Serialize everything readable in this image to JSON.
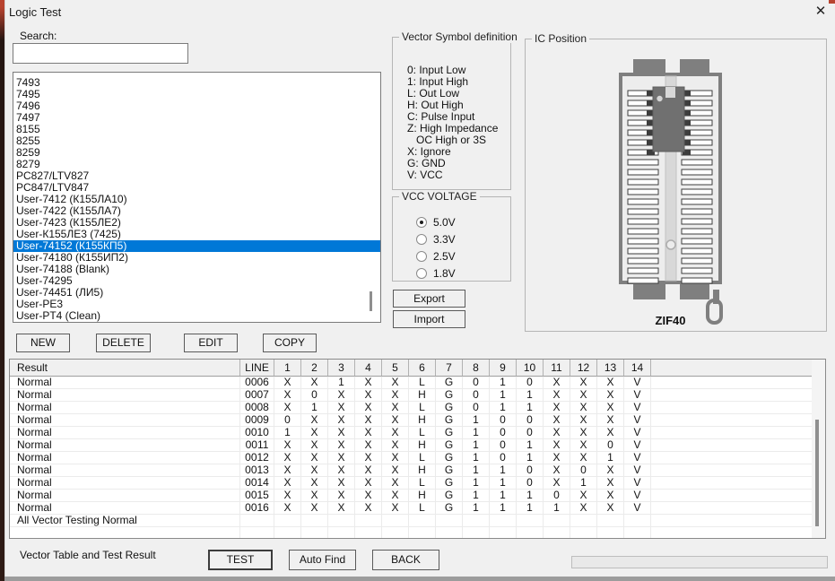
{
  "window": {
    "title": "Logic Test",
    "close_icon": "✕"
  },
  "search": {
    "label": "Search:",
    "value": ""
  },
  "chip_list": {
    "selected_index": 14,
    "items": [
      "7493",
      "7495",
      "7496",
      "7497",
      "8155",
      "8255",
      "8259",
      "8279",
      "PC827/LTV827",
      "PC847/LTV847",
      "User-7412 (К155ЛА10)",
      "User-7422 (К155ЛА7)",
      "User-7423 (К155ЛЕ2)",
      "User-К155ЛЕ3 (7425)",
      "User-74152 (К155КП5)",
      "User-74180 (К155ИП2)",
      "User-74188 (Blank)",
      "User-74295",
      "User-74451 (ЛИ5)",
      "User-PE3",
      "User-PT4 (Clean)"
    ]
  },
  "list_actions": {
    "new": "NEW",
    "delete": "DELETE",
    "edit": "EDIT",
    "copy": "COPY"
  },
  "vector_symbols": {
    "title": "Vector Symbol definition",
    "lines": [
      "0: Input Low",
      "1: Input High",
      "L: Out Low",
      "H: Out High",
      "C: Pulse Input",
      "Z: High Impedance",
      "   OC High or 3S",
      "X: Ignore",
      "G: GND",
      "V: VCC"
    ]
  },
  "vcc_voltage": {
    "title": "VCC VOLTAGE",
    "options": [
      "5.0V",
      "3.3V",
      "2.5V",
      "1.8V"
    ],
    "selected": "5.0V"
  },
  "transfer": {
    "export": "Export",
    "import": "Import"
  },
  "ic_position": {
    "title": "IC Position",
    "socket_label": "ZIF40"
  },
  "vector_table": {
    "result_header": "Result",
    "line_header": "LINE",
    "pin_headers": [
      "1",
      "2",
      "3",
      "4",
      "5",
      "6",
      "7",
      "8",
      "9",
      "10",
      "11",
      "12",
      "13",
      "14"
    ],
    "rows": [
      {
        "result": "Normal",
        "line": "0006",
        "pins": [
          "X",
          "X",
          "1",
          "X",
          "X",
          "L",
          "G",
          "0",
          "1",
          "0",
          "X",
          "X",
          "X",
          "V"
        ]
      },
      {
        "result": "Normal",
        "line": "0007",
        "pins": [
          "X",
          "0",
          "X",
          "X",
          "X",
          "H",
          "G",
          "0",
          "1",
          "1",
          "X",
          "X",
          "X",
          "V"
        ]
      },
      {
        "result": "Normal",
        "line": "0008",
        "pins": [
          "X",
          "1",
          "X",
          "X",
          "X",
          "L",
          "G",
          "0",
          "1",
          "1",
          "X",
          "X",
          "X",
          "V"
        ]
      },
      {
        "result": "Normal",
        "line": "0009",
        "pins": [
          "0",
          "X",
          "X",
          "X",
          "X",
          "H",
          "G",
          "1",
          "0",
          "0",
          "X",
          "X",
          "X",
          "V"
        ]
      },
      {
        "result": "Normal",
        "line": "0010",
        "pins": [
          "1",
          "X",
          "X",
          "X",
          "X",
          "L",
          "G",
          "1",
          "0",
          "0",
          "X",
          "X",
          "X",
          "V"
        ]
      },
      {
        "result": "Normal",
        "line": "0011",
        "pins": [
          "X",
          "X",
          "X",
          "X",
          "X",
          "H",
          "G",
          "1",
          "0",
          "1",
          "X",
          "X",
          "0",
          "V"
        ]
      },
      {
        "result": "Normal",
        "line": "0012",
        "pins": [
          "X",
          "X",
          "X",
          "X",
          "X",
          "L",
          "G",
          "1",
          "0",
          "1",
          "X",
          "X",
          "1",
          "V"
        ]
      },
      {
        "result": "Normal",
        "line": "0013",
        "pins": [
          "X",
          "X",
          "X",
          "X",
          "X",
          "H",
          "G",
          "1",
          "1",
          "0",
          "X",
          "0",
          "X",
          "V"
        ]
      },
      {
        "result": "Normal",
        "line": "0014",
        "pins": [
          "X",
          "X",
          "X",
          "X",
          "X",
          "L",
          "G",
          "1",
          "1",
          "0",
          "X",
          "1",
          "X",
          "V"
        ]
      },
      {
        "result": "Normal",
        "line": "0015",
        "pins": [
          "X",
          "X",
          "X",
          "X",
          "X",
          "H",
          "G",
          "1",
          "1",
          "1",
          "0",
          "X",
          "X",
          "V"
        ]
      },
      {
        "result": "Normal",
        "line": "0016",
        "pins": [
          "X",
          "X",
          "X",
          "X",
          "X",
          "L",
          "G",
          "1",
          "1",
          "1",
          "1",
          "X",
          "X",
          "V"
        ]
      }
    ],
    "summary_row": "All Vector Testing Normal"
  },
  "footer": {
    "status": "Vector Table and Test Result",
    "test": "TEST",
    "auto_find": "Auto Find",
    "back": "BACK"
  },
  "colors": {
    "selection": "#0078d7",
    "socket_gray": "#7f7f7f"
  }
}
